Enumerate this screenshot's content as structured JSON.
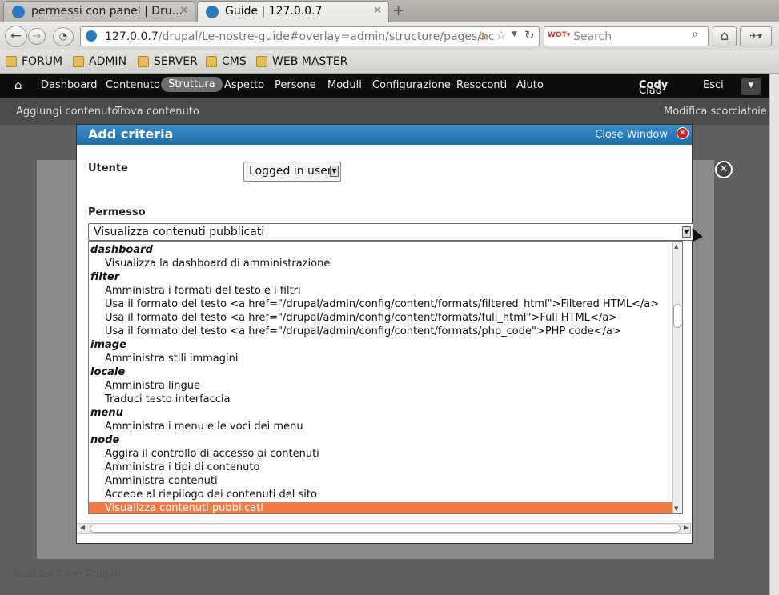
{
  "browser": {
    "tabs": [
      {
        "title": "permessi con panel | Dru...",
        "active": false
      },
      {
        "title": "Guide | 127.0.0.7",
        "active": true
      }
    ],
    "url_host": "127.0.0.7",
    "url_path": "/drupal/Le-nostre-guide#overlay=admin/structure/pages/nc",
    "search_placeholder": "Search",
    "bookmarks": [
      "FORUM",
      "ADMIN",
      "SERVER",
      "CMS",
      "WEB MASTER"
    ]
  },
  "toolbar": {
    "items": [
      "Dashboard",
      "Contenuto",
      "Struttura",
      "Aspetto",
      "Persone",
      "Moduli",
      "Configurazione",
      "Resoconti",
      "Aiuto"
    ],
    "active": "Struttura",
    "greeting": "Ciao",
    "user": "Cody",
    "logout": "Esci"
  },
  "shortcuts": {
    "items": [
      "Aggiungi contenuto",
      "Trova contenuto"
    ],
    "edit": "Modifica scorciatoie"
  },
  "dialog": {
    "title": "Add criteria",
    "close_label": "Close Window",
    "utente_label": "Utente",
    "utente_value": "Logged in user",
    "permesso_label": "Permesso",
    "permesso_value": "Visualizza contenuti pubblicati",
    "options": [
      {
        "type": "group",
        "text": "dashboard"
      },
      {
        "type": "option",
        "text": "Visualizza la dashboard di amministrazione"
      },
      {
        "type": "group",
        "text": "filter"
      },
      {
        "type": "option",
        "text": "Amministra i formati del testo e i filtri"
      },
      {
        "type": "option",
        "text": "Usa il formato del testo <a href=\"/drupal/admin/config/content/formats/filtered_html\">Filtered HTML</a>"
      },
      {
        "type": "option",
        "text": "Usa il formato del testo <a href=\"/drupal/admin/config/content/formats/full_html\">Full HTML</a>"
      },
      {
        "type": "option",
        "text": "Usa il formato del testo <a href=\"/drupal/admin/config/content/formats/php_code\">PHP code</a>"
      },
      {
        "type": "group",
        "text": "image"
      },
      {
        "type": "option",
        "text": "Amministra stili immagini"
      },
      {
        "type": "group",
        "text": "locale"
      },
      {
        "type": "option",
        "text": "Amministra lingue"
      },
      {
        "type": "option",
        "text": "Traduci testo interfaccia"
      },
      {
        "type": "group",
        "text": "menu"
      },
      {
        "type": "option",
        "text": "Amministra i menu e le voci dei menu"
      },
      {
        "type": "group",
        "text": "node"
      },
      {
        "type": "option",
        "text": "Aggira il controllo di accesso ai contenuti"
      },
      {
        "type": "option",
        "text": "Amministra i tipi di contenuto"
      },
      {
        "type": "option",
        "text": "Amministra contenuti"
      },
      {
        "type": "option",
        "text": "Accede al riepilogo dei contenuti del sito"
      },
      {
        "type": "option",
        "text": "Visualizza contenuti pubblicati",
        "selected": true
      }
    ]
  },
  "footer": "Realizzato con Drupal"
}
